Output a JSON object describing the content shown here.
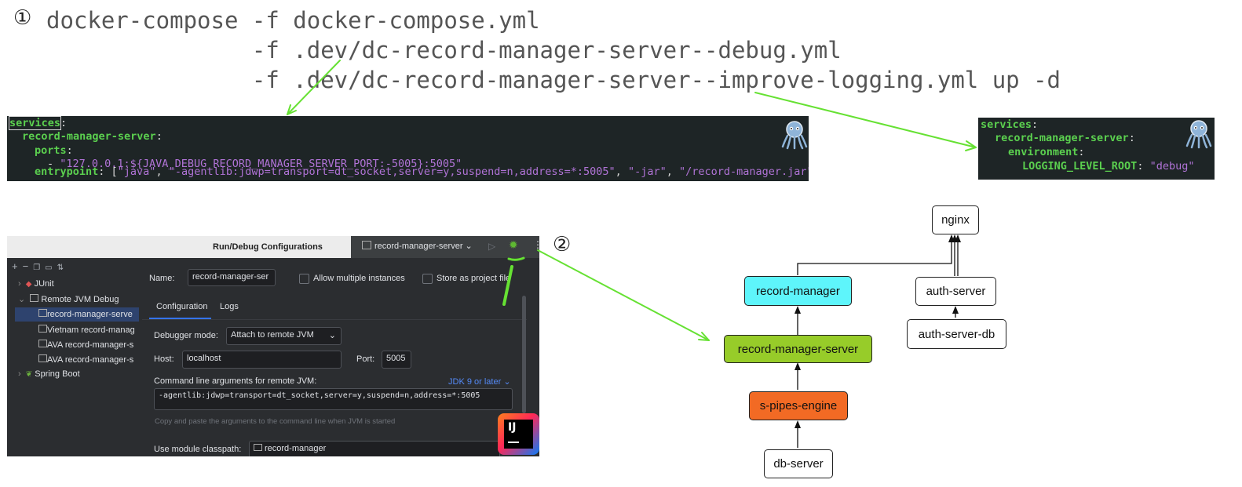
{
  "step1": {
    "marker": "①",
    "lines": [
      "docker-compose -f docker-compose.yml",
      "               -f .dev/dc-record-manager-server--debug.yml",
      "               -f .dev/dc-record-manager-server--improve-logging.yml up -d"
    ]
  },
  "yaml_debug": {
    "services": "services",
    "service_name": "record-manager-server",
    "ports_key": "ports",
    "port_value": "\"127.0.0.1:${JAVA_DEBUG_RECORD_MANAGER_SERVER_PORT:-5005}:5005\"",
    "entrypoint_key": "entrypoint",
    "entrypoint_items": [
      "\"java\"",
      "\"-agentlib:jdwp=transport=dt_socket,server=y,suspend=n,address=*:5005\"",
      "\"-jar\"",
      "\"/record-manager.jar\""
    ]
  },
  "yaml_logging": {
    "services": "services",
    "service_name": "record-manager-server",
    "env_key": "environment",
    "var_key": "LOGGING_LEVEL_ROOT",
    "var_value": "\"debug\""
  },
  "step2": {
    "marker": "②"
  },
  "ide": {
    "dialog_title": "Run/Debug Configurations",
    "run_config_selector": "record-manager-server",
    "tree": {
      "junit": "JUnit",
      "remote_jvm": "Remote JVM Debug",
      "items": [
        "record-manager-serve",
        "Vietnam record-manag",
        "AVA record-manager-s",
        "AVA record-manager-s"
      ],
      "spring_boot": "Spring Boot"
    },
    "name_label": "Name:",
    "name_value": "record-manager-ser",
    "allow_multiple": "Allow multiple instances",
    "store_project": "Store as project file",
    "tabs": [
      "Configuration",
      "Logs"
    ],
    "debugger_mode_label": "Debugger mode:",
    "debugger_mode_value": "Attach to remote JVM",
    "host_label": "Host:",
    "host_value": "localhost",
    "port_label": "Port:",
    "port_value": "5005",
    "cmd_label": "Command line arguments for remote JVM:",
    "jdk_select": "JDK 9 or later",
    "cmd_value": "-agentlib:jdwp=transport=dt_socket,server=y,suspend=n,address=*:5005",
    "cmd_hint": "Copy and paste the arguments to the command line when JVM is started",
    "classpath_label": "Use module classpath:",
    "classpath_value": "record-manager",
    "logo": "IJ"
  },
  "diagram": {
    "nodes": {
      "nginx": "nginx",
      "record_manager": "record-manager",
      "auth_server": "auth-server",
      "auth_server_db": "auth-server-db",
      "record_manager_server": "record-manager-server",
      "s_pipes_engine": "s-pipes-engine",
      "db_server": "db-server"
    },
    "colors": {
      "record_manager": "#5ef5fb",
      "record_manager_server": "#97cc29",
      "s_pipes_engine": "#f26a24"
    }
  },
  "colors": {
    "arrow": "#66e133",
    "yaml_key": "#5bd04f",
    "yaml_string": "#b073d6"
  }
}
